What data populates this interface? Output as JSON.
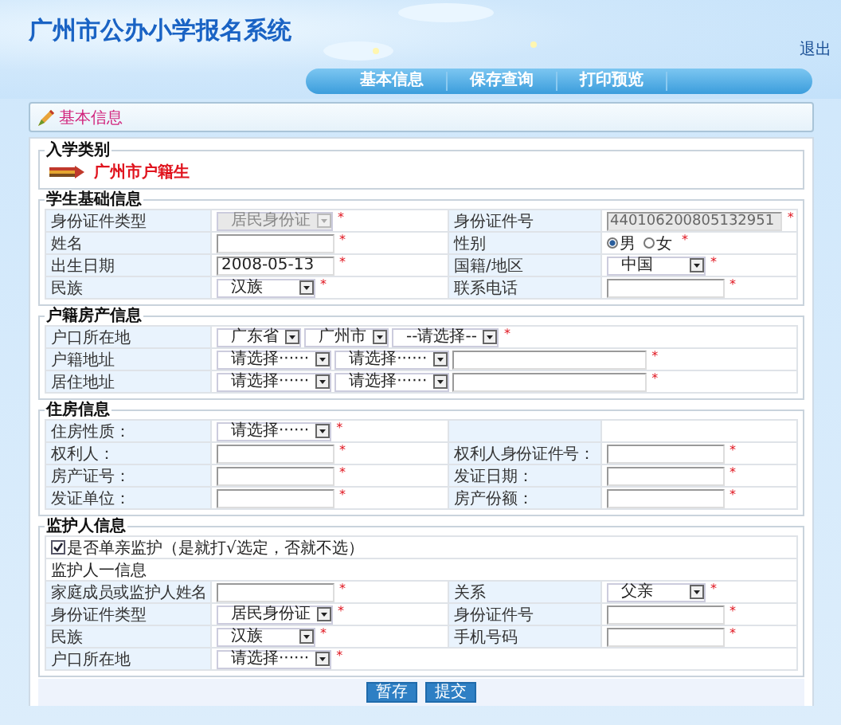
{
  "header": {
    "title": "广州市公办小学报名系统",
    "logout": "退出"
  },
  "nav": [
    {
      "label": "基本信息"
    },
    {
      "label": "保存查询"
    },
    {
      "label": "打印预览"
    }
  ],
  "breadcrumb": "基本信息",
  "enrollment": {
    "legend": "入学类别",
    "category": "广州市户籍生"
  },
  "sections": [
    {
      "legend": "学生基础信息",
      "rows": [
        {
          "cells": [
            {
              "kind": "label",
              "text": "身份证件类型"
            },
            {
              "kind": "controls",
              "items": [
                {
                  "kind": "select",
                  "value": "居民身份证",
                  "disabled": true,
                  "req": "*"
                }
              ]
            },
            {
              "kind": "label",
              "text": "身份证件号"
            },
            {
              "kind": "controls",
              "items": [
                {
                  "kind": "text",
                  "value": "440106200805132951",
                  "disabled": true,
                  "req": "*"
                }
              ]
            }
          ]
        },
        {
          "cells": [
            {
              "kind": "label",
              "text": "姓名"
            },
            {
              "kind": "controls",
              "items": [
                {
                  "kind": "text",
                  "disabled": false,
                  "req": "*"
                }
              ]
            },
            {
              "kind": "label",
              "text": "性别"
            },
            {
              "kind": "controls",
              "items": [
                {
                  "kind": "radio",
                  "options": [
                    {
                      "label": "男",
                      "selected": true
                    },
                    {
                      "label": "女",
                      "selected": false
                    }
                  ],
                  "req": "*"
                }
              ]
            }
          ]
        },
        {
          "cells": [
            {
              "kind": "label",
              "text": "出生日期"
            },
            {
              "kind": "controls",
              "items": [
                {
                  "kind": "text",
                  "value": "2008-05-13",
                  "disabled": false,
                  "req": "*"
                }
              ]
            },
            {
              "kind": "label",
              "text": "国籍/地区"
            },
            {
              "kind": "controls",
              "items": [
                {
                  "kind": "select",
                  "value": "中国",
                  "disabled": false,
                  "req": "*"
                }
              ]
            }
          ]
        },
        {
          "cells": [
            {
              "kind": "label",
              "text": "民族"
            },
            {
              "kind": "controls",
              "items": [
                {
                  "kind": "select",
                  "value": "汉族",
                  "disabled": false,
                  "req": "*"
                }
              ]
            },
            {
              "kind": "label",
              "text": "联系电话"
            },
            {
              "kind": "controls",
              "items": [
                {
                  "kind": "text",
                  "disabled": false,
                  "req": "*"
                }
              ]
            }
          ]
        }
      ]
    },
    {
      "legend": "户籍房产信息",
      "rows": [
        {
          "cells": [
            {
              "kind": "label",
              "text": "户口所在地"
            },
            {
              "kind": "controls",
              "items": [
                {
                  "kind": "select",
                  "value": "广东省",
                  "disabled": false
                },
                {
                  "kind": "select",
                  "value": "广州市",
                  "disabled": false
                },
                {
                  "kind": "select",
                  "value": "--请选择--",
                  "disabled": false,
                  "req": "*"
                }
              ]
            }
          ]
        },
        {
          "cells": [
            {
              "kind": "label",
              "text": "户籍地址"
            },
            {
              "kind": "controls",
              "items": [
                {
                  "kind": "select",
                  "value": "请选择······",
                  "disabled": false
                },
                {
                  "kind": "select",
                  "value": "请选择······",
                  "disabled": false
                },
                {
                  "kind": "text",
                  "disabled": false,
                  "req": "*"
                }
              ]
            }
          ]
        },
        {
          "cells": [
            {
              "kind": "label",
              "text": "居住地址"
            },
            {
              "kind": "controls",
              "items": [
                {
                  "kind": "select",
                  "value": "请选择······",
                  "disabled": false
                },
                {
                  "kind": "select",
                  "value": "请选择······",
                  "disabled": false
                },
                {
                  "kind": "text",
                  "disabled": false,
                  "req": "*"
                }
              ]
            }
          ]
        }
      ]
    },
    {
      "legend": "住房信息",
      "rows": [
        {
          "cells": [
            {
              "kind": "label",
              "text": "住房性质："
            },
            {
              "kind": "controls",
              "items": [
                {
                  "kind": "select",
                  "value": "请选择······",
                  "disabled": false,
                  "req": "*"
                }
              ]
            },
            {
              "kind": "blank-label"
            },
            {
              "kind": "blank"
            }
          ]
        },
        {
          "cells": [
            {
              "kind": "label",
              "text": "权利人："
            },
            {
              "kind": "controls",
              "items": [
                {
                  "kind": "text",
                  "disabled": false,
                  "req": "*"
                }
              ]
            },
            {
              "kind": "label",
              "text": "权利人身份证件号："
            },
            {
              "kind": "controls",
              "items": [
                {
                  "kind": "text",
                  "disabled": false,
                  "req": "*"
                }
              ]
            }
          ]
        },
        {
          "cells": [
            {
              "kind": "label",
              "text": "房产证号："
            },
            {
              "kind": "controls",
              "items": [
                {
                  "kind": "text",
                  "disabled": false,
                  "req": "*"
                }
              ]
            },
            {
              "kind": "label",
              "text": "发证日期："
            },
            {
              "kind": "controls",
              "items": [
                {
                  "kind": "text",
                  "disabled": false,
                  "req": "*"
                }
              ]
            }
          ]
        },
        {
          "cells": [
            {
              "kind": "label",
              "text": "发证单位："
            },
            {
              "kind": "controls",
              "items": [
                {
                  "kind": "text",
                  "disabled": false,
                  "req": "*"
                }
              ]
            },
            {
              "kind": "label",
              "text": "房产份额："
            },
            {
              "kind": "controls",
              "items": [
                {
                  "kind": "text",
                  "disabled": false,
                  "req": "*"
                }
              ]
            }
          ]
        }
      ]
    },
    {
      "legend": "监护人信息",
      "rows": [
        {
          "cells": [
            {
              "kind": "controls",
              "items": [
                {
                  "kind": "checkbox",
                  "label": "是否单亲监护（是就打√选定，否就不选）",
                  "checked": true
                }
              ]
            }
          ]
        },
        {
          "cells": [
            {
              "kind": "note",
              "text": "监护人一信息"
            }
          ]
        },
        {
          "cells": [
            {
              "kind": "label",
              "text": "家庭成员或监护人姓名"
            },
            {
              "kind": "controls",
              "items": [
                {
                  "kind": "text",
                  "disabled": false,
                  "req": "*"
                }
              ]
            },
            {
              "kind": "label",
              "text": "关系"
            },
            {
              "kind": "controls",
              "items": [
                {
                  "kind": "select",
                  "value": "父亲",
                  "disabled": false,
                  "req": "*"
                }
              ]
            }
          ]
        },
        {
          "cells": [
            {
              "kind": "label",
              "text": "身份证件类型"
            },
            {
              "kind": "controls",
              "items": [
                {
                  "kind": "select",
                  "value": "居民身份证",
                  "disabled": false,
                  "req": "*"
                }
              ]
            },
            {
              "kind": "label",
              "text": "身份证件号"
            },
            {
              "kind": "controls",
              "items": [
                {
                  "kind": "text",
                  "disabled": false,
                  "req": "*"
                }
              ]
            }
          ]
        },
        {
          "cells": [
            {
              "kind": "label",
              "text": "民族"
            },
            {
              "kind": "controls",
              "items": [
                {
                  "kind": "select",
                  "value": "汉族",
                  "disabled": false,
                  "req": "*"
                }
              ]
            },
            {
              "kind": "label",
              "text": "手机号码"
            },
            {
              "kind": "controls",
              "items": [
                {
                  "kind": "text",
                  "disabled": false,
                  "req": "*"
                }
              ]
            }
          ]
        },
        {
          "cells": [
            {
              "kind": "label",
              "text": "户口所在地"
            },
            {
              "kind": "controls",
              "items": [
                {
                  "kind": "select",
                  "value": "请选择······",
                  "disabled": false,
                  "req": "*"
                }
              ]
            }
          ]
        }
      ]
    }
  ],
  "actions": [
    {
      "label": "暂存"
    },
    {
      "label": "提交"
    }
  ]
}
